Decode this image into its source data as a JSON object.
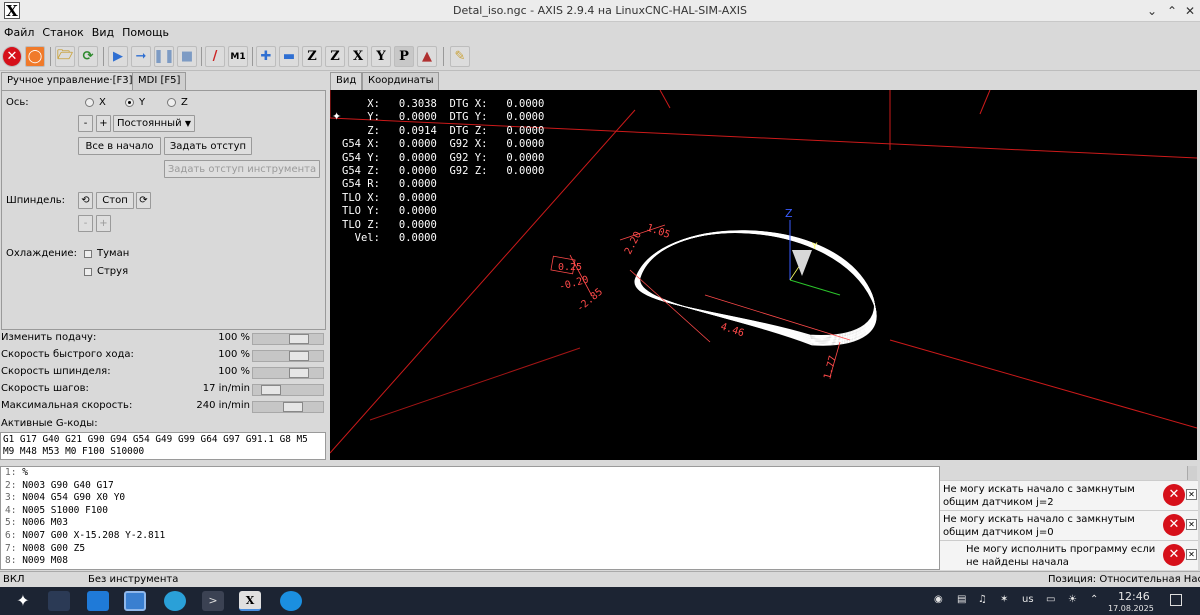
{
  "window": {
    "title": "Detal_iso.ngc - AXIS 2.9.4 на LinuxCNC-HAL-SIM-AXIS",
    "logo": "X"
  },
  "menu": [
    "Файл",
    "Станок",
    "Вид",
    "Помощь"
  ],
  "left_tabs": [
    "Ручное управление·[F3]",
    "MDI [F5]"
  ],
  "manual": {
    "axis_label": "Ось:",
    "axes": [
      "X",
      "Y",
      "Z"
    ],
    "selected_axis": "Y",
    "minus": "-",
    "plus": "+",
    "jog_mode": "Постоянный",
    "home_all": "Все в начало",
    "touch_off": "Задать отступ",
    "tool_touch_off": "Задать отступ инструмента",
    "spindle_label": "Шпиндель:",
    "spindle_stop": "Стоп",
    "coolant_label": "Охлаждение:",
    "mist": "Туман",
    "flood": "Струя"
  },
  "overrides": [
    {
      "label": "Изменить подачу:",
      "value": "100 %",
      "level": 0.72
    },
    {
      "label": "Скорость быстрого хода:",
      "value": "100 %",
      "level": 0.72
    },
    {
      "label": "Скорость шпинделя:",
      "value": "100 %",
      "level": 0.72
    },
    {
      "label": "Скорость шагов:",
      "value": "17 in/min",
      "level": 0.15
    },
    {
      "label": "Максимальная скорость:",
      "value": "240 in/min",
      "level": 0.6
    }
  ],
  "active_gcodes_label": "Активные G-коды:",
  "active_gcodes": "G1 G17 G40 G21 G90 G94 G54 G49 G99 G64 G97 G91.1 G8 M5 M9 M48 M53 M0 F100 S10000",
  "right_tabs": [
    "Вид",
    "Координаты"
  ],
  "dro": [
    "    X:   0.3038  DTG X:   0.0000",
    "    Y:   0.0000  DTG Y:   0.0000",
    "    Z:   0.0914  DTG Z:   0.0000",
    "G54 X:   0.0000  G92 X:   0.0000",
    "G54 Y:   0.0000  G92 Y:   0.0000",
    "G54 Z:   0.0000  G92 Z:   0.0000",
    "G54 R:   0.0000",
    "TLO X:   0.0000",
    "TLO Y:   0.0000",
    "TLO Z:   0.0000",
    "  Vel:   0.0000"
  ],
  "preview": {
    "dims": [
      "4.46",
      "1.77",
      "-2.85",
      "2.20",
      "0.25",
      "-0.20",
      "1.05"
    ],
    "axis_z": "Z",
    "axis_y": "Y",
    "axis_x": "X"
  },
  "program": [
    {
      "n": "1:",
      "code": "%"
    },
    {
      "n": "2:",
      "code": "N003 G90 G40 G17"
    },
    {
      "n": "3:",
      "code": "N004 G54 G90 X0 Y0"
    },
    {
      "n": "4:",
      "code": "N005 S1000 F100"
    },
    {
      "n": "5:",
      "code": "N006 M03"
    },
    {
      "n": "6:",
      "code": "N007 G00 X-15.208 Y-2.811"
    },
    {
      "n": "7:",
      "code": "N008 G00 Z5"
    },
    {
      "n": "8:",
      "code": "N009 M08"
    }
  ],
  "notifications": [
    "Не могу искать начало с замкнутым общим датчиком j=2",
    "Не могу искать начало с замкнутым общим датчиком j=0",
    "Не могу исполнить программу если не найдены начала"
  ],
  "status": {
    "state": "ВКЛ",
    "tool": "Без инструмента",
    "position": "Позиция: Относительная Нас"
  },
  "tray": {
    "lang": "us",
    "time": "12:46",
    "date": "17.08.2025"
  },
  "colors": {
    "accent": "#d6101a",
    "canvas": "#000000",
    "limits": "#cc1a1a",
    "toolpath": "#ffffff"
  }
}
